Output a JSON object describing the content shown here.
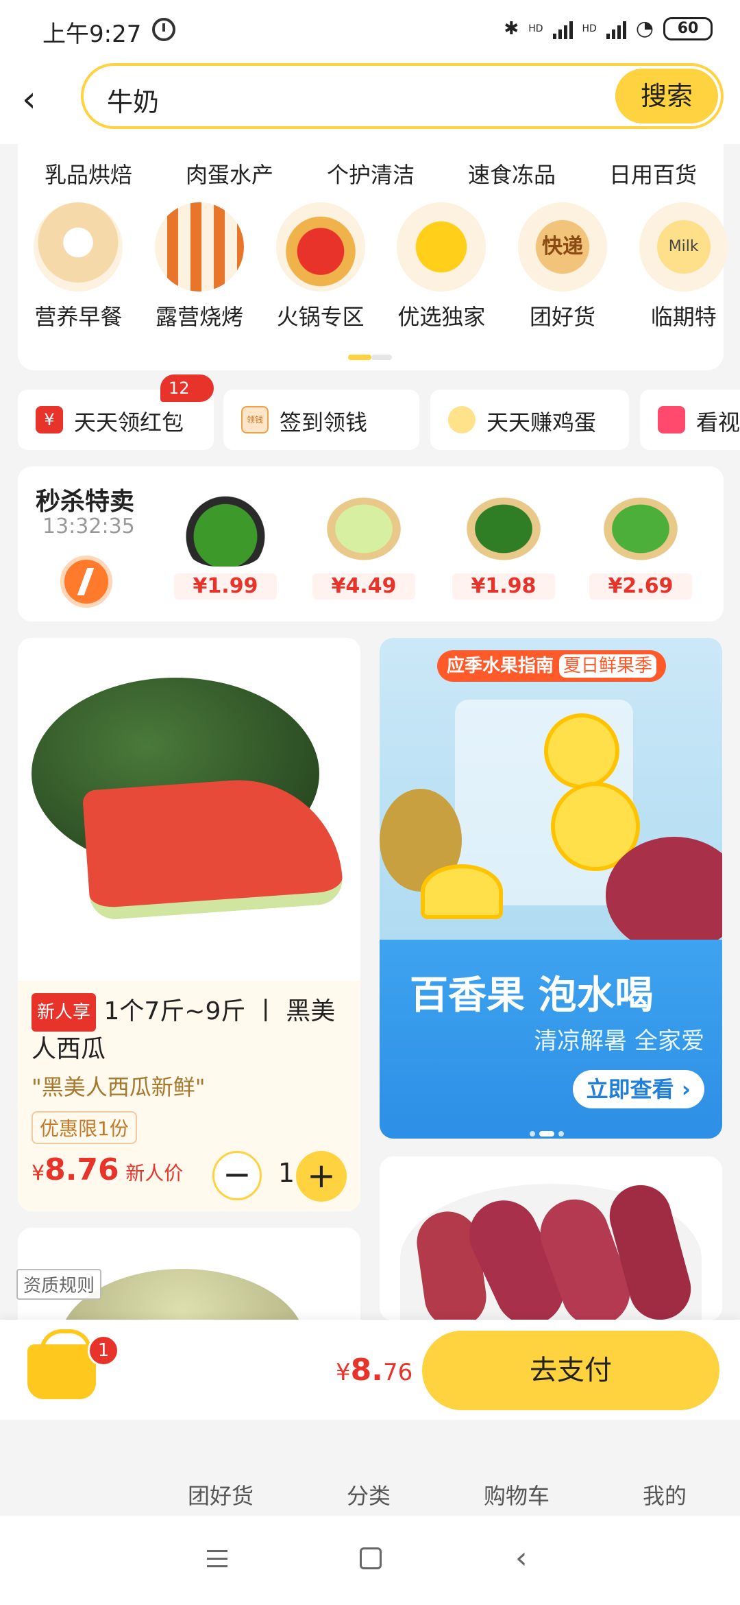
{
  "status_bar": {
    "time": "上午9:27",
    "net1": "HD",
    "net2": "HD",
    "battery": "60"
  },
  "search": {
    "query": "牛奶",
    "button": "搜索"
  },
  "categories_row1": [
    "乳品烘焙",
    "肉蛋水产",
    "个护清洁",
    "速食冻品",
    "日用百货"
  ],
  "categories_row2": [
    {
      "label": "营养早餐",
      "icon": "dumpling-steamer-icon",
      "icon_text": ""
    },
    {
      "label": "露营烧烤",
      "icon": "bbq-skewer-icon",
      "icon_text": ""
    },
    {
      "label": "火锅专区",
      "icon": "hotpot-icon",
      "icon_text": ""
    },
    {
      "label": "优选独家",
      "icon": "yellow-mascot-icon",
      "icon_text": ""
    },
    {
      "label": "团好货",
      "icon": "express-box-icon",
      "icon_text": "快递"
    },
    {
      "label": "临期特",
      "icon": "milk-carton-icon",
      "icon_text": "Milk"
    }
  ],
  "benefits": {
    "red_packet": "天天领红包",
    "red_packet_badge": "12元",
    "sign_in": "签到领钱",
    "sign_in_icon_text": "领钱",
    "eggs": "天天赚鸡蛋",
    "video": "看视"
  },
  "flash_sale": {
    "title": "秒杀特卖",
    "countdown": "13:32:35",
    "items": [
      {
        "name": "green-pepper",
        "price": "¥1.99"
      },
      {
        "name": "cabbage",
        "price": "¥4.49"
      },
      {
        "name": "okra",
        "price": "¥1.98"
      },
      {
        "name": "greens",
        "price": "¥2.69"
      }
    ]
  },
  "product": {
    "tag": "新人享",
    "title": "1个7斤~9斤 丨 黑美人西瓜",
    "subtitle": "\"黑美人西瓜新鲜\"",
    "limit": "优惠限1份",
    "price_symbol": "¥",
    "price": "8.76",
    "price_note": "新人价",
    "quantity": "1",
    "minus": "−",
    "plus": "+"
  },
  "banner": {
    "tag": "应季水果指南",
    "tag_highlight": "夏日鲜果季",
    "headline": "百香果 泡水喝",
    "subline": "清凉解暑 全家爱",
    "cta": "立即查看 ›"
  },
  "qualification": "资质规则",
  "cart": {
    "badge": "1",
    "total_symbol": "¥",
    "total_int": "8.",
    "total_dec": "76",
    "pay": "去支付"
  },
  "bottom_nav": [
    "团好货",
    "分类",
    "购物车",
    "我的"
  ],
  "colors": {
    "accent": "#ffd23f",
    "price_red": "#e8332b",
    "banner_blue": "#2d8fe5"
  }
}
